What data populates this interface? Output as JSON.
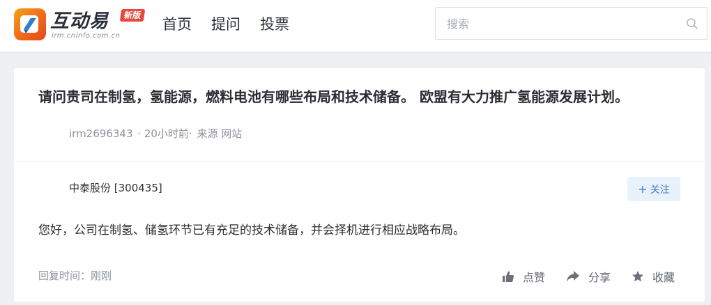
{
  "header": {
    "logo_name": "互动易",
    "logo_domain": "irm.cninfo.com.cn",
    "logo_badge": "新版",
    "nav": [
      "首页",
      "提问",
      "投票"
    ],
    "search_placeholder": "搜索"
  },
  "question": {
    "title": "请问贵司在制氢，氢能源，燃料电池有哪些布局和技术储备。 欧盟有大力推广氢能源发展计划。",
    "user": "irm2696343",
    "time": "· 20小时前·",
    "source": "来源 网站"
  },
  "answer": {
    "company": "中泰股份 [300435]",
    "follow_label": "关注",
    "text": "您好，公司在制氢、储氢环节已有充足的技术储备，并会择机进行相应战略布局。",
    "reply_time": "回复时间：刚刚",
    "actions": {
      "like": "点赞",
      "share": "分享",
      "collect": "收藏"
    }
  },
  "colors": {
    "accent": "#3a7cc9",
    "follow_bg": "#e9f2fb",
    "logo_orange": "#ef6a1a",
    "badge_red": "#e8473a",
    "page_bg": "#eef0f3"
  }
}
